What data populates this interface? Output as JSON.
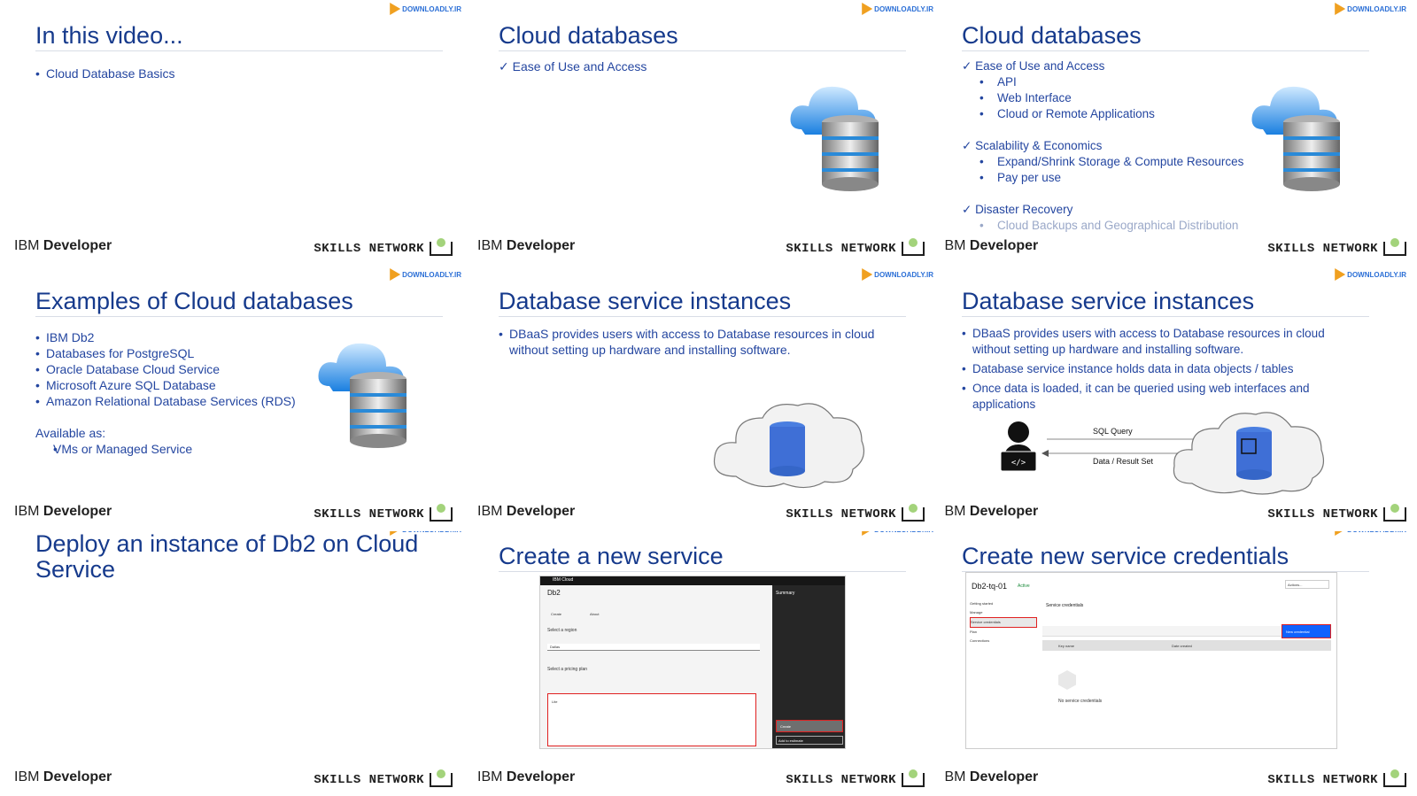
{
  "common": {
    "brand_left_prefix": "IBM",
    "brand_left_bold": "Developer",
    "brand_right": "SKILLS NETWORK",
    "download_logo": "DOWNLOADLY.IR"
  },
  "slides": [
    {
      "title": "In this video...",
      "items": [
        "Cloud Database Basics"
      ]
    },
    {
      "title": "Cloud databases",
      "items": [
        "Ease of Use and Access"
      ]
    },
    {
      "title": "Cloud databases",
      "groups": [
        {
          "head": "Ease of Use and Access",
          "subs": [
            "API",
            "Web Interface",
            "Cloud or Remote Applications"
          ]
        },
        {
          "head": "Scalability & Economics",
          "subs": [
            "Expand/Shrink Storage & Compute Resources",
            "Pay per use"
          ]
        },
        {
          "head": "Disaster Recovery",
          "subs": [
            "Cloud Backups and Geographical Distribution"
          ]
        }
      ]
    },
    {
      "title": "Examples of Cloud databases",
      "items": [
        "IBM Db2",
        "Databases for PostgreSQL",
        "Oracle Database Cloud Service",
        "Microsoft Azure SQL Database",
        "Amazon Relational Database Services (RDS)"
      ],
      "available_label": "Available as:",
      "available_items": [
        "VMs or Managed Service"
      ]
    },
    {
      "title": "Database service instances",
      "items": [
        "DBaaS provides users with access to Database resources in cloud without setting up hardware and installing software."
      ]
    },
    {
      "title": "Database service instances",
      "items": [
        "DBaaS provides users with access to Database resources in cloud without setting up hardware and installing software.",
        "Database service instance holds data in data objects / tables",
        "Once data is loaded, it can be queried using web interfaces and applications"
      ],
      "diagram": {
        "query_label": "SQL Query",
        "result_label": "Data / Result Set"
      }
    },
    {
      "title": "Deploy an instance of Db2 on Cloud Service"
    },
    {
      "title": "Create a new service",
      "shot": {
        "app": "IBM Cloud",
        "heading": "Db2",
        "tab1": "Create",
        "tab2": "About",
        "region_label": "Select a region",
        "region_value": "Dallas",
        "plan_label": "Select a pricing plan",
        "plan_name": "Lite",
        "summary": "Summary",
        "create_btn": "Create",
        "add_estimate": "Add to estimate"
      }
    },
    {
      "title": "Create new service credentials",
      "shot": {
        "heading": "Db2-tq-01",
        "status": "Active",
        "section": "Service credentials",
        "menu": [
          "Getting started",
          "Manage",
          "Service credentials",
          "Plan",
          "Connections"
        ],
        "new_btn": "New credential",
        "col1": "Key name",
        "col2": "Date created",
        "empty": "No service credentials",
        "actions": "Actions..."
      }
    }
  ]
}
